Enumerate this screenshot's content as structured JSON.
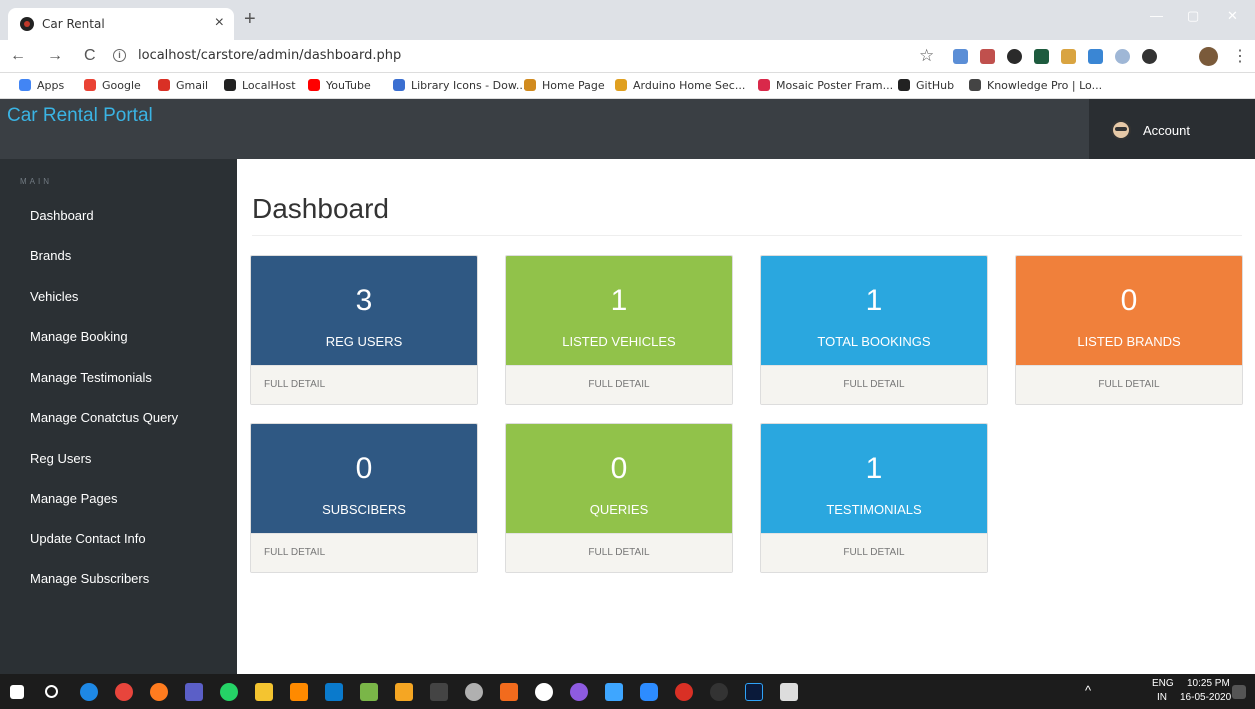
{
  "browser": {
    "tab_title": "Car Rental",
    "tab_close": "×",
    "new_tab": "+",
    "back": "←",
    "forward": "→",
    "reload": "C",
    "url": "localhost/carstore/admin/dashboard.php",
    "star": "☆",
    "menu": "⋮",
    "min": "—",
    "max": "▢",
    "close": "✕"
  },
  "bookmarks": [
    {
      "label": "Apps",
      "color": "#4285f4"
    },
    {
      "label": "Google",
      "color": "#ea4335"
    },
    {
      "label": "Gmail",
      "color": "#d93025"
    },
    {
      "label": "LocalHost",
      "color": "#222222"
    },
    {
      "label": "YouTube",
      "color": "#ff0000"
    },
    {
      "label": "Library Icons - Dow...",
      "color": "#3b6fd1"
    },
    {
      "label": "Home Page",
      "color": "#d18b1f"
    },
    {
      "label": "Arduino Home Sec...",
      "color": "#e0a020"
    },
    {
      "label": "Mosaic Poster Fram...",
      "color": "#d9294a"
    },
    {
      "label": "GitHub",
      "color": "#222222"
    },
    {
      "label": "Knowledge Pro | Lo...",
      "color": "#444444"
    }
  ],
  "app": {
    "brand": "Car Rental Portal",
    "account_label": "Account"
  },
  "sidebar": {
    "heading": "MAIN",
    "items": [
      {
        "label": "Dashboard"
      },
      {
        "label": "Brands"
      },
      {
        "label": "Vehicles"
      },
      {
        "label": "Manage Booking"
      },
      {
        "label": "Manage Testimonials"
      },
      {
        "label": "Manage Conatctus Query"
      },
      {
        "label": "Reg Users"
      },
      {
        "label": "Manage Pages"
      },
      {
        "label": "Update Contact Info"
      },
      {
        "label": "Manage Subscribers"
      }
    ]
  },
  "main": {
    "title": "Dashboard",
    "cards": [
      {
        "count": "3",
        "label": "REG USERS",
        "link": "FULL DETAIL",
        "color": "#2f5883"
      },
      {
        "count": "1",
        "label": "LISTED VEHICLES",
        "link": "FULL DETAIL",
        "color": "#91c24a"
      },
      {
        "count": "1",
        "label": "TOTAL BOOKINGS",
        "link": "FULL DETAIL",
        "color": "#2aa7df"
      },
      {
        "count": "0",
        "label": "LISTED BRANDS",
        "link": "FULL DETAIL",
        "color": "#f0803b"
      },
      {
        "count": "0",
        "label": "SUBSCIBERS",
        "link": "FULL DETAIL",
        "color": "#2f5883"
      },
      {
        "count": "0",
        "label": "QUERIES",
        "link": "FULL DETAIL",
        "color": "#91c24a"
      },
      {
        "count": "1",
        "label": "TESTIMONIALS",
        "link": "FULL DETAIL",
        "color": "#2aa7df"
      }
    ]
  },
  "taskbar": {
    "lang_top": "ENG",
    "lang_bottom": "IN",
    "time": "10:25 PM",
    "date": "16-05-2020"
  }
}
